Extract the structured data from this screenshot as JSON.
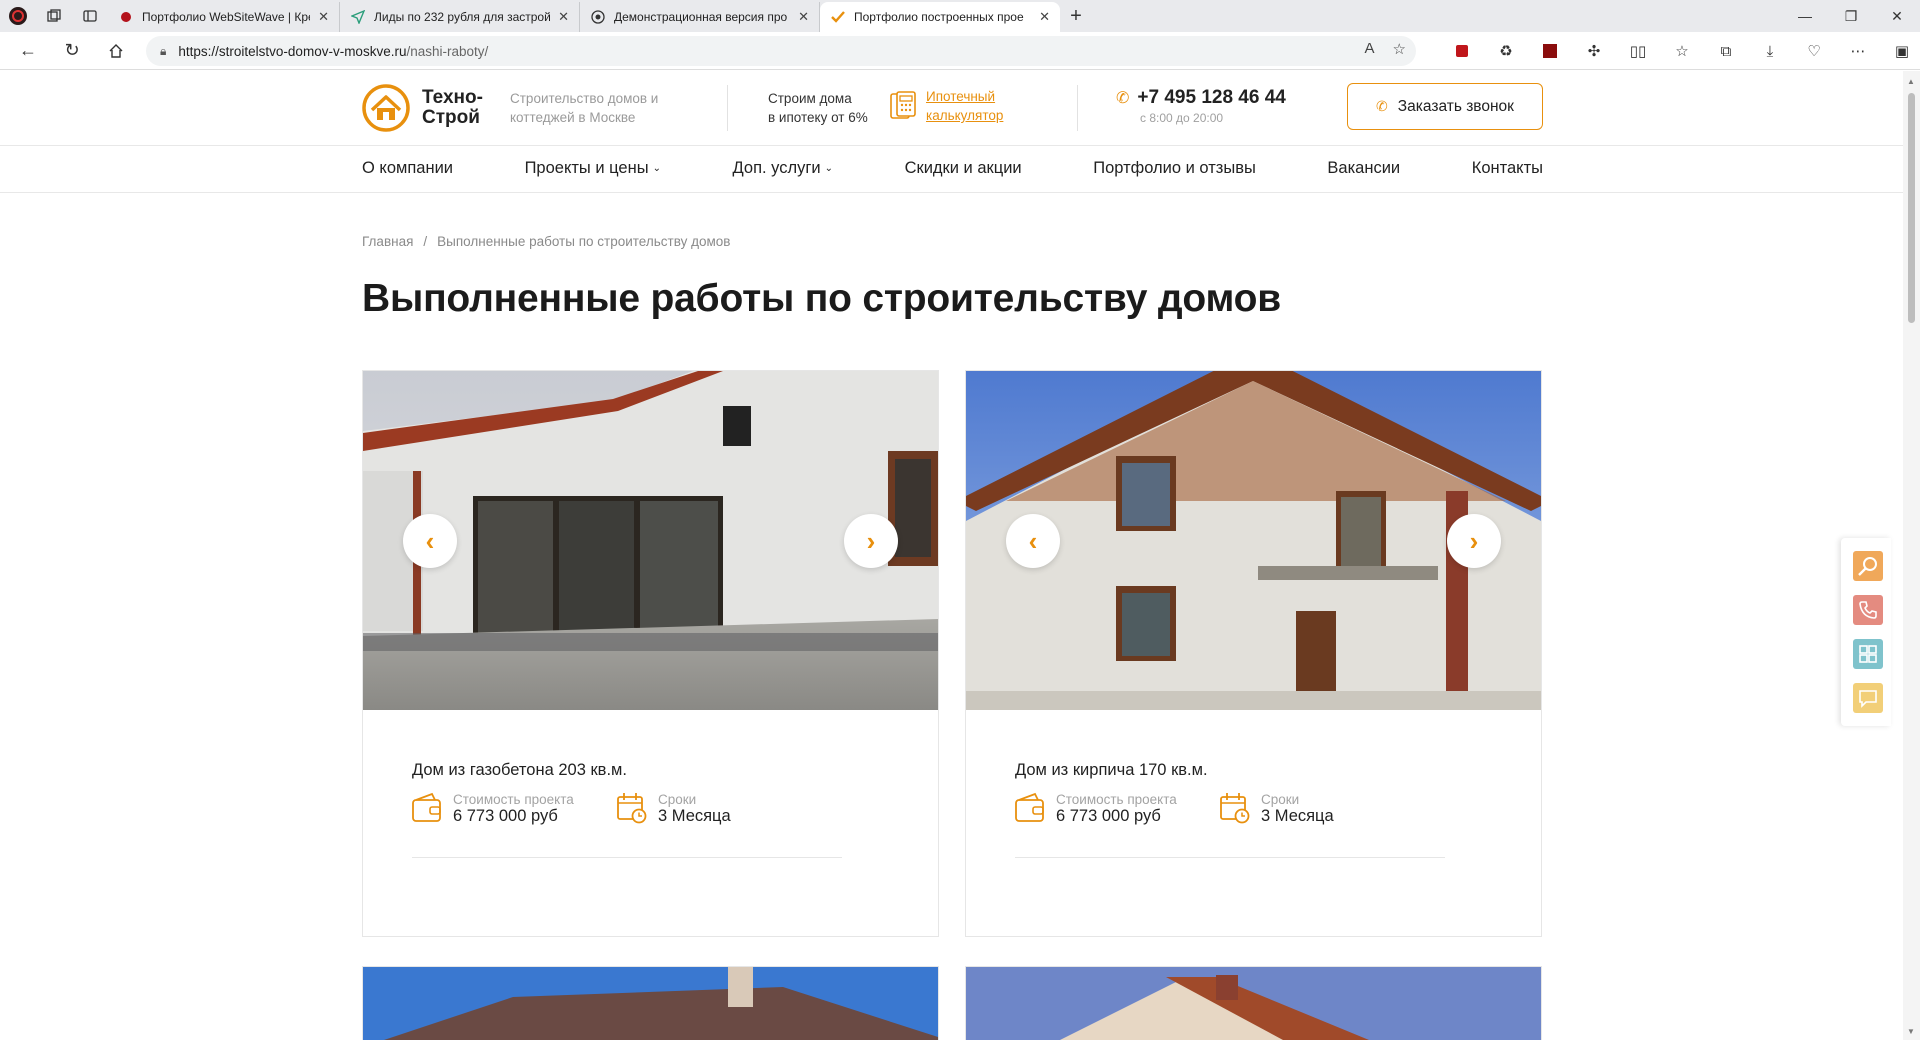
{
  "browser": {
    "tabs": [
      {
        "label": "Портфолио WebSiteWave | Креа",
        "active": false
      },
      {
        "label": "Лиды по 232 рубля для застрой",
        "active": false
      },
      {
        "label": "Демонстрационная версия про",
        "active": false
      },
      {
        "label": "Портфолио построенных прое",
        "active": true
      }
    ],
    "url_host": "https://stroitelstvo-domov-v-moskve.ru",
    "url_path": "/nashi-raboty/"
  },
  "site": {
    "logo_line1": "Техно-",
    "logo_line2": "Строй",
    "tagline": "Строительство домов и коттеджей в Москве",
    "mortgage_line1": "Строим дома",
    "mortgage_line2": "в ипотеку от 6%",
    "calc_line1": "Ипотечный",
    "calc_line2": "калькулятор",
    "phone": "+7 495 128 46 44",
    "hours": "с 8:00 до 20:00",
    "callback_label": "Заказать звонок",
    "accent_color": "#e8900e"
  },
  "nav": [
    {
      "label": "О компании",
      "dropdown": false
    },
    {
      "label": "Проекты и цены",
      "dropdown": true
    },
    {
      "label": "Доп. услуги",
      "dropdown": true
    },
    {
      "label": "Скидки и акции",
      "dropdown": false
    },
    {
      "label": "Портфолио и отзывы",
      "dropdown": false
    },
    {
      "label": "Вакансии",
      "dropdown": false
    },
    {
      "label": "Контакты",
      "dropdown": false
    }
  ],
  "breadcrumb": {
    "home": "Главная",
    "sep": "/",
    "current": "Выполненные работы по строительству домов"
  },
  "page_title": "Выполненные работы по строительству домов",
  "projects": [
    {
      "title": "Дом из газобетона 203 кв.м.",
      "cost_label": "Стоимость проекта",
      "cost_value": "6 773 000 руб",
      "term_label": "Сроки",
      "term_value": "3 Месяца"
    },
    {
      "title": "Дом из кирпича 170 кв.м.",
      "cost_label": "Стоимость проекта",
      "cost_value": "6 773 000 руб",
      "term_label": "Сроки",
      "term_value": "3 Месяца"
    }
  ],
  "side_widgets": [
    "search-icon",
    "phone-icon",
    "grid-icon",
    "chat-icon"
  ]
}
